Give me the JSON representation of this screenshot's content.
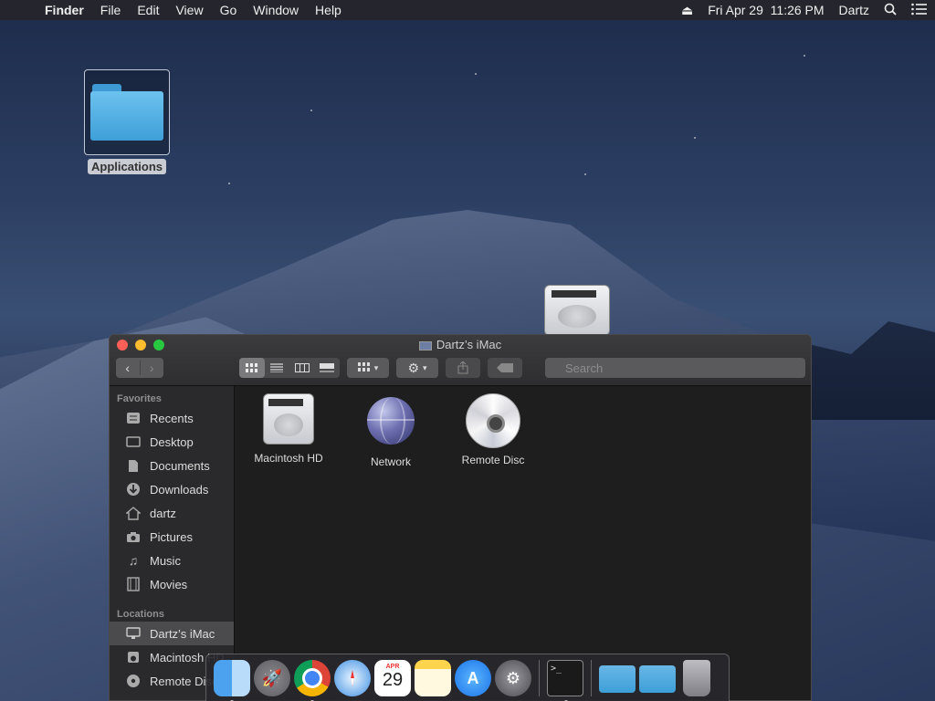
{
  "menubar": {
    "app_name": "Finder",
    "menus": [
      "File",
      "Edit",
      "View",
      "Go",
      "Window",
      "Help"
    ],
    "eject_icon": "⏏",
    "datetime": "Fri Apr 29  11:26 PM",
    "user": "Dartz"
  },
  "desktop": {
    "folder_label": "Applications"
  },
  "window": {
    "title": "Dartz’s iMac",
    "search_placeholder": "Search",
    "sidebar": {
      "favorites_header": "Favorites",
      "favorites": [
        {
          "label": "Recents",
          "icon": "recents-icon"
        },
        {
          "label": "Desktop",
          "icon": "desktop-icon"
        },
        {
          "label": "Documents",
          "icon": "documents-icon"
        },
        {
          "label": "Downloads",
          "icon": "downloads-icon"
        },
        {
          "label": "dartz",
          "icon": "home-icon"
        },
        {
          "label": "Pictures",
          "icon": "camera-icon"
        },
        {
          "label": "Music",
          "icon": "music-icon"
        },
        {
          "label": "Movies",
          "icon": "film-icon"
        }
      ],
      "locations_header": "Locations",
      "locations": [
        {
          "label": "Dartz’s iMac",
          "icon": "imac-icon",
          "selected": true
        },
        {
          "label": "Macintosh HD",
          "icon": "hard-drive-icon"
        },
        {
          "label": "Remote Disc",
          "icon": "disc-icon"
        }
      ]
    },
    "items": [
      {
        "label": "Macintosh HD",
        "icon": "hard-drive-icon"
      },
      {
        "label": "Network",
        "icon": "network-icon"
      },
      {
        "label": "Remote Disc",
        "icon": "disc-icon"
      }
    ]
  },
  "dock": {
    "calendar_month": "APR",
    "calendar_day": "29",
    "terminal_prompt": ">_"
  }
}
